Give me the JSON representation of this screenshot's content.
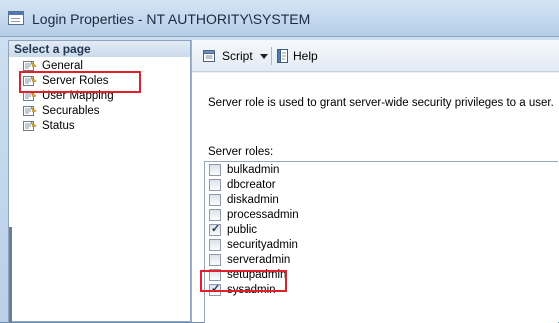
{
  "window": {
    "title": "Login Properties - NT AUTHORITY\\SYSTEM",
    "title_icon": "properties-window-icon"
  },
  "sidebar": {
    "header": "Select a page",
    "items": [
      {
        "label": "General",
        "icon": "page-icon"
      },
      {
        "label": "Server Roles",
        "icon": "page-icon",
        "highlighted": true
      },
      {
        "label": "User Mapping",
        "icon": "page-icon"
      },
      {
        "label": "Securables",
        "icon": "page-icon"
      },
      {
        "label": "Status",
        "icon": "page-icon"
      }
    ]
  },
  "toolbar": {
    "script_label": "Script",
    "script_icon": "script-icon",
    "script_dropdown_icon": "chevron-down-icon",
    "help_label": "Help",
    "help_icon": "help-book-icon"
  },
  "main": {
    "description": "Server role is used to grant server-wide security privileges to a user.",
    "roles_label": "Server roles:",
    "roles": [
      {
        "name": "bulkadmin",
        "checked": false
      },
      {
        "name": "dbcreator",
        "checked": false
      },
      {
        "name": "diskadmin",
        "checked": false
      },
      {
        "name": "processadmin",
        "checked": false
      },
      {
        "name": "public",
        "checked": true
      },
      {
        "name": "securityadmin",
        "checked": false
      },
      {
        "name": "serveradmin",
        "checked": false
      },
      {
        "name": "setupadmin",
        "checked": false
      },
      {
        "name": "sysadmin",
        "checked": true,
        "highlighted": true
      }
    ]
  },
  "colors": {
    "highlight_border": "#e0202a",
    "title_bar": "#c3d8ee"
  }
}
